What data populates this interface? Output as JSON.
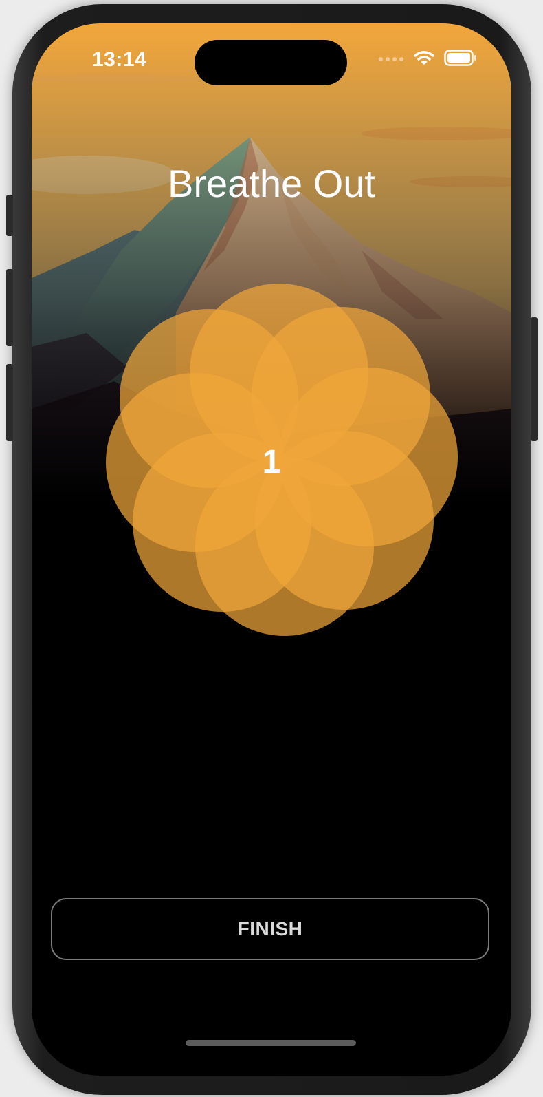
{
  "status_bar": {
    "time": "13:14",
    "signal_icon": "cellular-signal-icon",
    "wifi_icon": "wifi-icon",
    "battery_icon": "battery-icon"
  },
  "session": {
    "phase": "Breathe Out",
    "count": "1"
  },
  "finish_button": {
    "label": "FINISH"
  },
  "colors": {
    "accent": "#F0A63A",
    "sky_top": "#F2A93E",
    "background": "#000000",
    "button_border": "#7A7A7A"
  }
}
